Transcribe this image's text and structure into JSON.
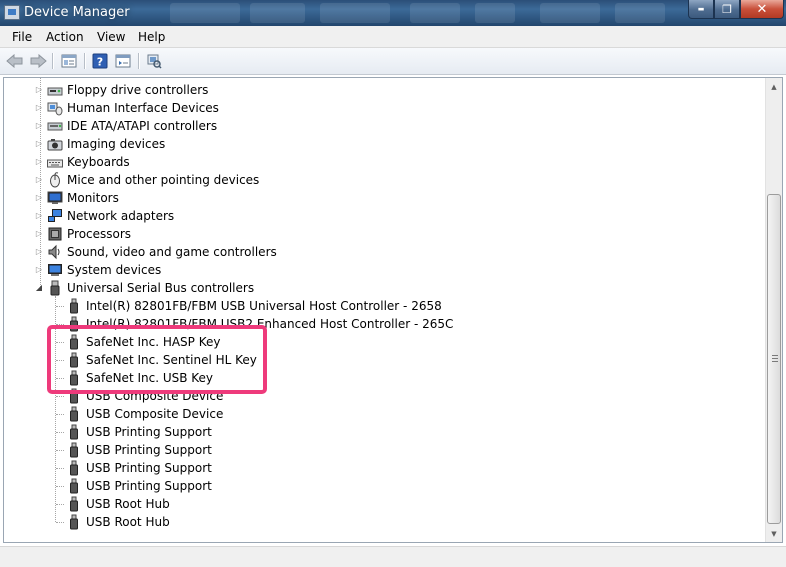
{
  "window": {
    "title": "Device Manager"
  },
  "caption_buttons": {
    "minimize": "▬",
    "maximize": "❐",
    "close": "✕"
  },
  "menu": [
    "File",
    "Action",
    "View",
    "Help"
  ],
  "toolbar": [
    "back-arrow-icon",
    "forward-arrow-icon",
    "properties-icon",
    "help-icon",
    "show-hidden-icon",
    "scan-hardware-icon"
  ],
  "tree": {
    "categories": [
      {
        "label": "Floppy drive controllers",
        "icon": "floppy-controller-icon",
        "expanded": false
      },
      {
        "label": "Human Interface Devices",
        "icon": "hid-icon",
        "expanded": false
      },
      {
        "label": "IDE ATA/ATAPI controllers",
        "icon": "ide-controller-icon",
        "expanded": false
      },
      {
        "label": "Imaging devices",
        "icon": "camera-icon",
        "expanded": false
      },
      {
        "label": "Keyboards",
        "icon": "keyboard-icon",
        "expanded": false
      },
      {
        "label": "Mice and other pointing devices",
        "icon": "mouse-icon",
        "expanded": false
      },
      {
        "label": "Monitors",
        "icon": "monitor-icon",
        "expanded": false
      },
      {
        "label": "Network adapters",
        "icon": "network-adapter-icon",
        "expanded": false
      },
      {
        "label": "Processors",
        "icon": "processor-icon",
        "expanded": false
      },
      {
        "label": "Sound, video and game controllers",
        "icon": "speaker-icon",
        "expanded": false
      },
      {
        "label": "System devices",
        "icon": "system-devices-icon",
        "expanded": false
      },
      {
        "label": "Universal Serial Bus controllers",
        "icon": "usb-icon",
        "expanded": true
      }
    ],
    "usb_children": [
      "Intel(R) 82801FB/FBM USB Universal Host Controller - 2658",
      "Intel(R) 82801FB/FBM USB2 Enhanced Host Controller - 265C",
      "SafeNet Inc. HASP Key",
      "SafeNet Inc. Sentinel HL Key",
      "SafeNet Inc. USB Key",
      "USB Composite Device",
      "USB Composite Device",
      "USB Printing Support",
      "USB Printing Support",
      "USB Printing Support",
      "USB Printing Support",
      "USB Root Hub",
      "USB Root Hub"
    ]
  },
  "scrollbar": {
    "up": "▲",
    "down": "▼"
  },
  "colors": {
    "highlight": "#ee3a7b",
    "titlebar": "#2b4f78",
    "tree_lines": "#a6a6a6"
  }
}
